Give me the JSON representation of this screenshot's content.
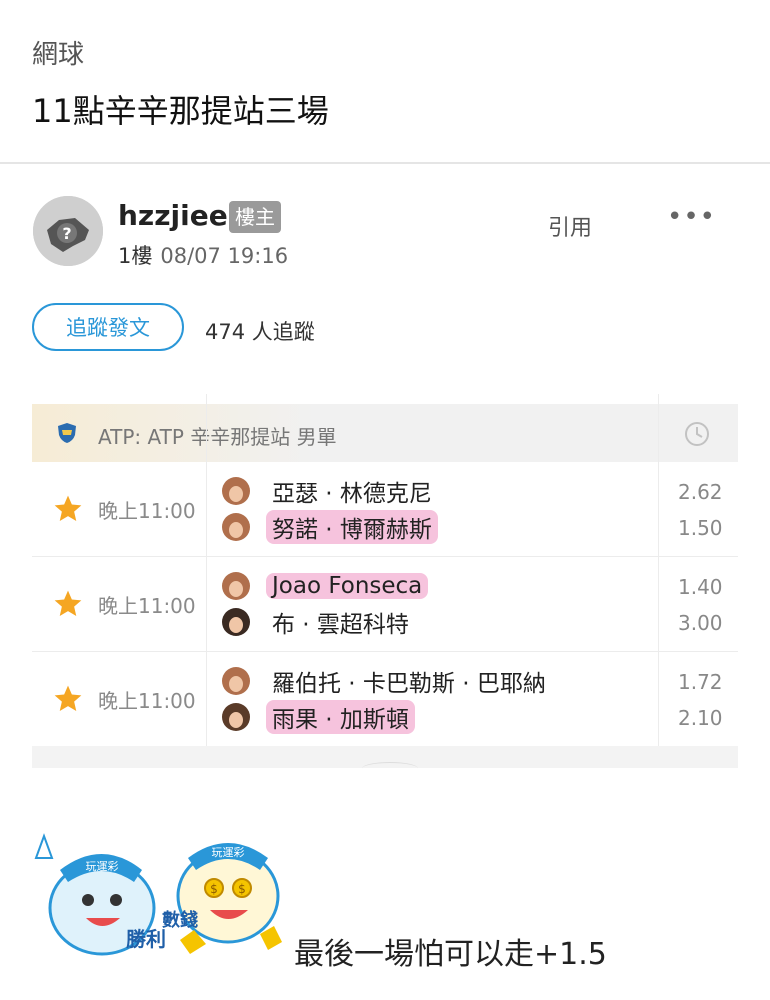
{
  "header": {
    "category": "網球",
    "title": "11點辛辛那提站三場"
  },
  "post": {
    "username": "hzzjiee",
    "owner_badge": "樓主",
    "floor": "1樓",
    "timestamp": "08/07 19:16",
    "quote_label": "引用",
    "more_label": "•••"
  },
  "follow": {
    "button_label": "追蹤發文",
    "count_text": "474 人追蹤"
  },
  "league": {
    "name": "ATP: ATP 辛辛那提站 男單"
  },
  "matches": [
    {
      "time": "晚上11:00",
      "players": [
        {
          "name": "亞瑟 · 林德克尼",
          "odds": "2.62",
          "highlight": false
        },
        {
          "name": "努諾 · 博爾赫斯",
          "odds": "1.50",
          "highlight": true
        }
      ]
    },
    {
      "time": "晚上11:00",
      "players": [
        {
          "name": "Joao Fonseca",
          "odds": "1.40",
          "highlight": true
        },
        {
          "name": "布 · 雲超科特",
          "odds": "3.00",
          "highlight": false
        }
      ]
    },
    {
      "time": "晚上11:00",
      "players": [
        {
          "name": "羅伯托 · 卡巴勒斯 · 巴耶納",
          "odds": "1.72",
          "highlight": false
        },
        {
          "name": "雨果 · 加斯頓",
          "odds": "2.10",
          "highlight": true
        }
      ]
    }
  ],
  "sticker": {
    "left_text": "勝利",
    "right_text": "數錢",
    "badge_text": "玩運彩"
  },
  "reply_text": "最後一場怕可以走+1.5",
  "colors": {
    "accent": "#2a97d8",
    "highlight": "#f6c3dd",
    "star": "#f5a623"
  }
}
